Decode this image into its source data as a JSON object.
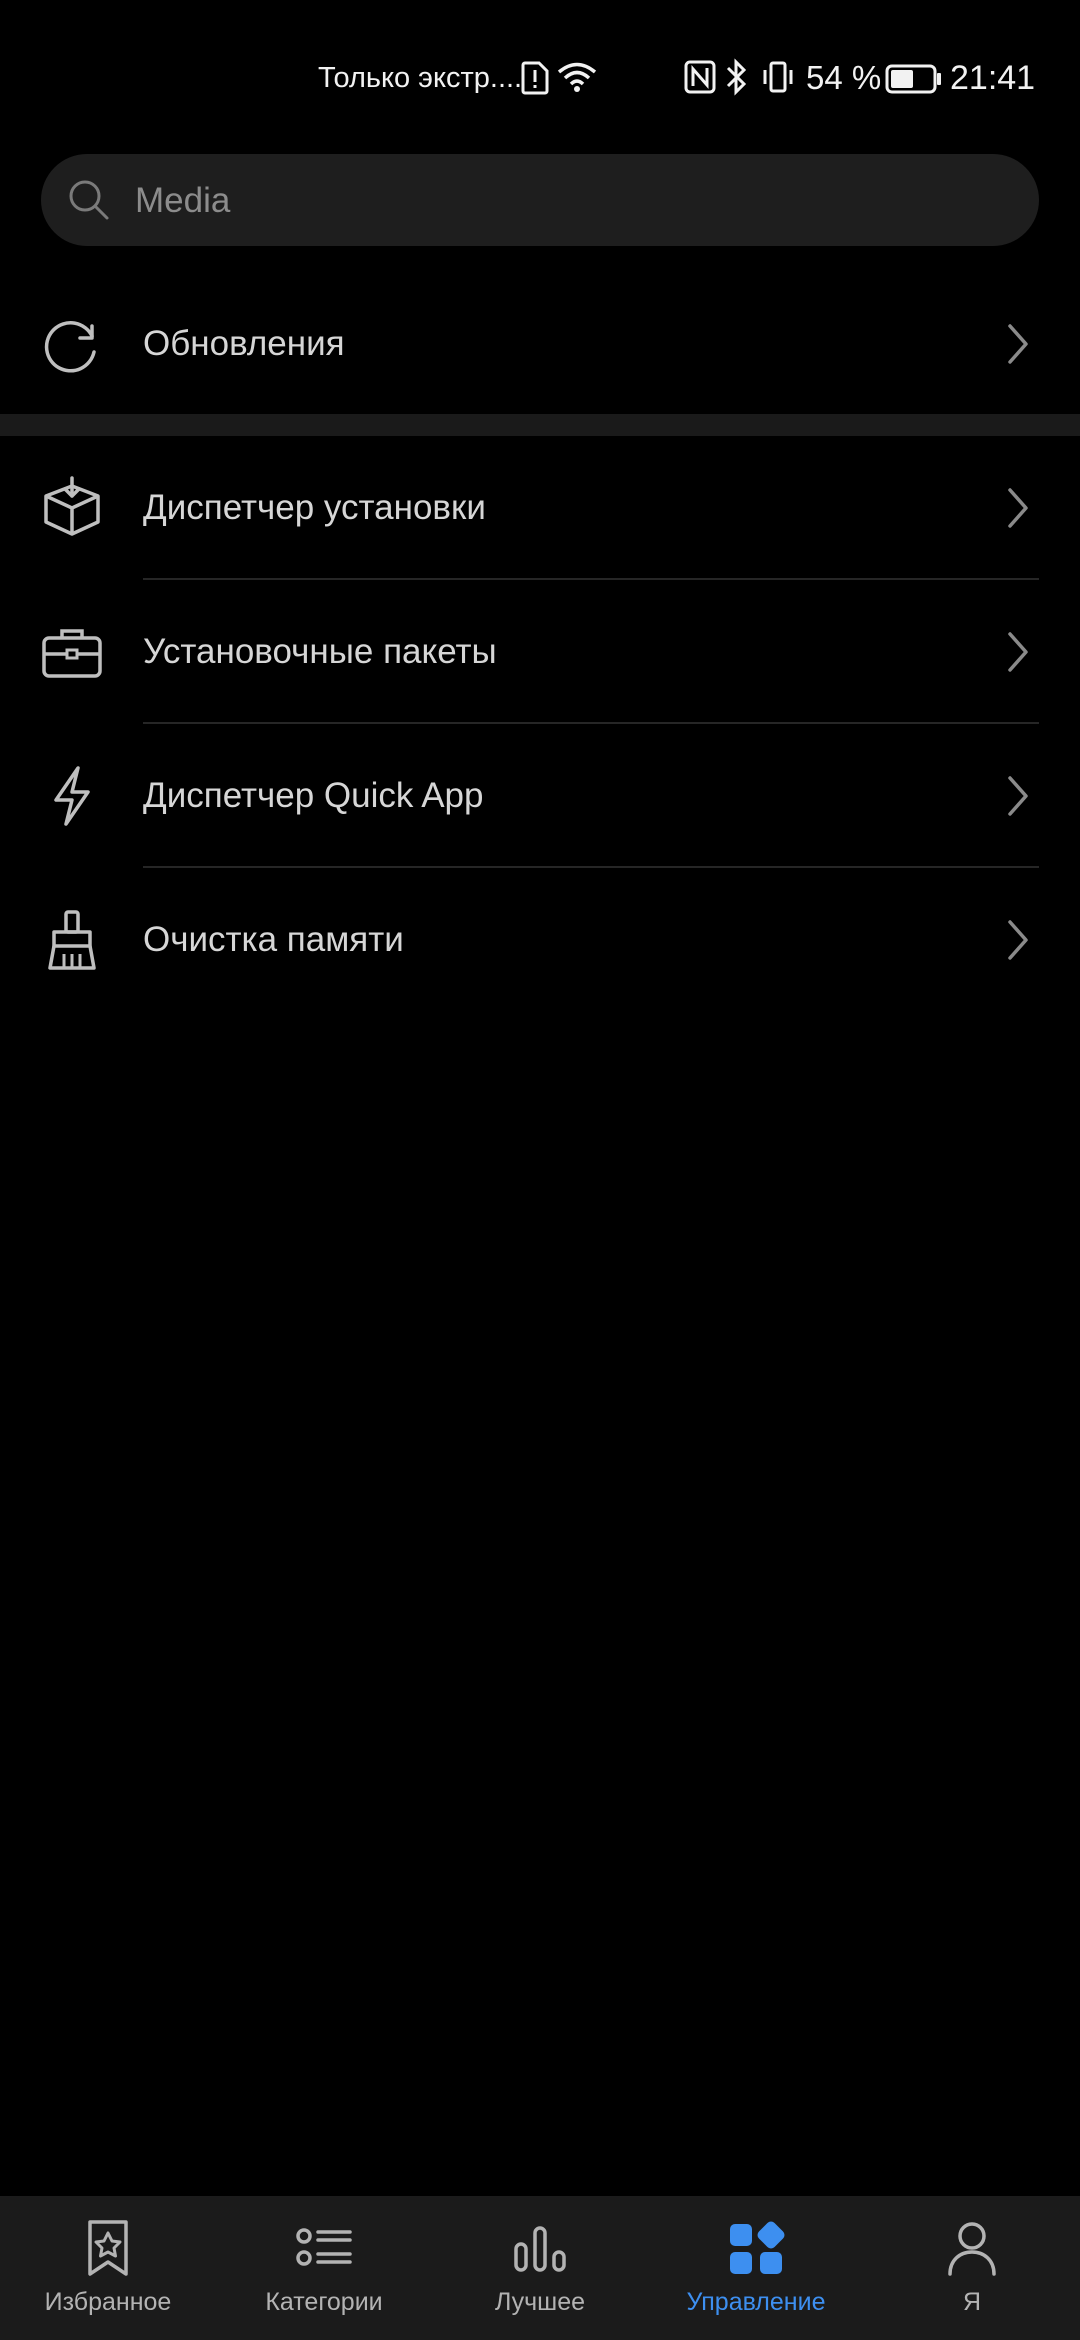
{
  "status_bar": {
    "carrier": "Только экстр....",
    "battery_percent": "54 %",
    "time": "21:41",
    "battery_level": 0.54
  },
  "search": {
    "placeholder": "Media",
    "icon": "search-icon"
  },
  "updates": {
    "label": "Обновления",
    "icon": "refresh-icon"
  },
  "manage_items": [
    {
      "label": "Диспетчер установки",
      "icon": "box-download-icon"
    },
    {
      "label": "Установочные пакеты",
      "icon": "briefcase-icon"
    },
    {
      "label": "Диспетчер Quick App",
      "icon": "lightning-icon"
    },
    {
      "label": "Очистка памяти",
      "icon": "broom-icon"
    }
  ],
  "bottom_nav": {
    "items": [
      {
        "label": "Избранное",
        "icon": "bookmark-star-icon",
        "active": false
      },
      {
        "label": "Категории",
        "icon": "list-icon",
        "active": false
      },
      {
        "label": "Лучшее",
        "icon": "bar-chart-icon",
        "active": false
      },
      {
        "label": "Управление",
        "icon": "apps-grid-icon",
        "active": true
      },
      {
        "label": "Я",
        "icon": "person-icon",
        "active": false
      }
    ]
  },
  "colors": {
    "background": "#000000",
    "accent": "#3d8ff0",
    "nav_background": "#1b1b1b",
    "search_background": "#1e1e1e"
  }
}
